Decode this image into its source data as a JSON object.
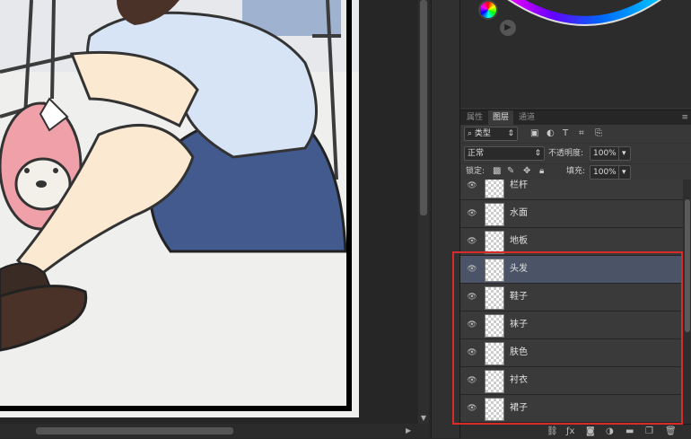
{
  "panel": {
    "tabs": [
      {
        "label": "属性",
        "active": false
      },
      {
        "label": "图层",
        "active": true
      },
      {
        "label": "通道",
        "active": false
      }
    ],
    "menu_icon": "≡",
    "filter": {
      "value": "类型",
      "icon": "search-icon"
    },
    "blend_mode": "正常",
    "opacity_label": "不透明度:",
    "opacity_value": "100%",
    "lock_label": "锁定:",
    "fill_label": "填充:",
    "fill_value": "100%"
  },
  "layers": [
    {
      "name": "栏杆",
      "selected": false,
      "visible": true
    },
    {
      "name": "水面",
      "selected": false,
      "visible": true
    },
    {
      "name": "地板",
      "selected": false,
      "visible": true
    },
    {
      "name": "头发",
      "selected": true,
      "visible": true
    },
    {
      "name": "鞋子",
      "selected": false,
      "visible": true
    },
    {
      "name": "袜子",
      "selected": false,
      "visible": true
    },
    {
      "name": "肤色",
      "selected": false,
      "visible": true
    },
    {
      "name": "衬衣",
      "selected": false,
      "visible": true
    },
    {
      "name": "裙子",
      "selected": false,
      "visible": true
    }
  ],
  "colors": {
    "highlight": "#d92b2b",
    "selected_layer": "#4a5466",
    "skirt": "#425a8e",
    "shirt": "#d6e4f6",
    "skin": "#fbe9d2",
    "shoes": "#4a3228",
    "plush": "#f0a0a8"
  }
}
